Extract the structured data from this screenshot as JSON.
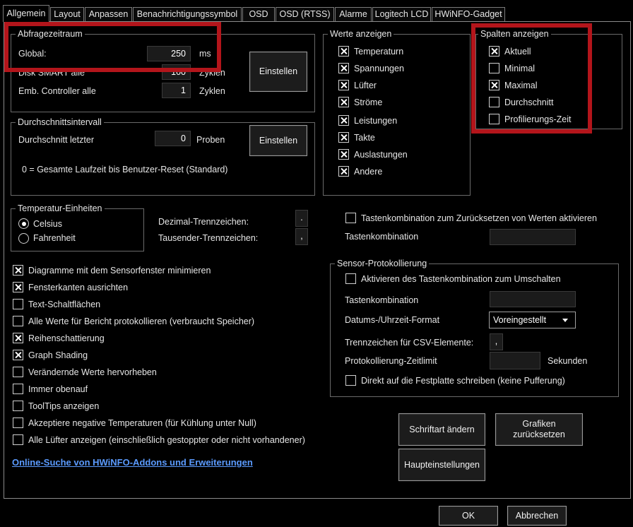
{
  "tabs": [
    "Allgemein",
    "Layout",
    "Anpassen",
    "Benachrichtigungssymbol",
    "OSD",
    "OSD (RTSS)",
    "Alarme",
    "Logitech LCD",
    "HWiNFO-Gadget"
  ],
  "poll": {
    "legend": "Abfragezeitraum",
    "global_label": "Global:",
    "global_value": "250",
    "global_unit": "ms",
    "smart_label": "Disk SMART alle",
    "smart_value": "100",
    "smart_unit": "Zyklen",
    "emb_label": "Emb. Controller alle",
    "emb_value": "1",
    "emb_unit": "Zyklen",
    "button": "Einstellen"
  },
  "avg": {
    "legend": "Durchschnittsintervall",
    "label": "Durchschnitt letzter",
    "value": "0",
    "unit": "Proben",
    "button": "Einstellen",
    "note": "0 = Gesamte Laufzeit bis Benutzer-Reset (Standard)"
  },
  "values": {
    "legend": "Werte anzeigen",
    "items": [
      {
        "label": "Temperaturn",
        "checked": true
      },
      {
        "label": "Spannungen",
        "checked": true
      },
      {
        "label": "Lüfter",
        "checked": true
      },
      {
        "label": "Ströme",
        "checked": true
      },
      {
        "label": "Leistungen",
        "checked": true
      },
      {
        "label": "Takte",
        "checked": true
      },
      {
        "label": "Auslastungen",
        "checked": true
      },
      {
        "label": "Andere",
        "checked": true
      }
    ]
  },
  "columns": {
    "legend": "Spalten anzeigen",
    "items": [
      {
        "label": "Aktuell",
        "checked": true
      },
      {
        "label": "Minimal",
        "checked": false
      },
      {
        "label": "Maximal",
        "checked": true
      },
      {
        "label": "Durchschnitt",
        "checked": false
      },
      {
        "label": "Profilierungs-Zeit",
        "checked": false
      }
    ]
  },
  "temp_units": {
    "legend": "Temperatur-Einheiten",
    "celsius": "Celsius",
    "fahrenheit": "Fahrenheit",
    "selected": "Celsius"
  },
  "separators": {
    "decimal_label": "Dezimal-Trennzeichen:",
    "decimal_value": ".",
    "thousand_label": "Tausender-Trennzeichen:",
    "thousand_value": ","
  },
  "options": [
    {
      "label": "Diagramme mit dem Sensorfenster minimieren",
      "checked": true
    },
    {
      "label": "Fensterkanten ausrichten",
      "checked": true
    },
    {
      "label": "Text-Schaltflächen",
      "checked": false
    },
    {
      "label": "Alle Werte für Bericht protokollieren (verbraucht Speicher)",
      "checked": false
    },
    {
      "label": "Reihenschattierung",
      "checked": true
    },
    {
      "label": "Graph Shading",
      "checked": true
    },
    {
      "label": "Verändernde Werte hervorheben",
      "checked": false
    },
    {
      "label": "Immer obenauf",
      "checked": false
    },
    {
      "label": "ToolTips anzeigen",
      "checked": false
    },
    {
      "label": "Akzeptiere negative Temperaturen (für Kühlung unter Null)",
      "checked": false
    },
    {
      "label": "Alle Lüfter anzeigen (einschließlich gestoppter oder nicht vorhandener)",
      "checked": false
    }
  ],
  "reset_hotkey": {
    "checkbox_label": "Tastenkombination zum Zurücksetzen von Werten aktivieren",
    "checked": false,
    "hotkey_label": "Tastenkombination",
    "hotkey_value": ""
  },
  "logging": {
    "legend": "Sensor-Protokollierung",
    "toggle_label": "Aktivieren des Tastenkombination zum Umschalten",
    "toggle_checked": false,
    "hotkey_label": "Tastenkombination",
    "hotkey_value": "",
    "datetime_label": "Datums-/Uhrzeit-Format",
    "datetime_value": "Voreingestellt",
    "csv_label": "Trennzeichen für CSV-Elemente:",
    "csv_value": ",",
    "timelimit_label": "Protokollierung-Zeitlimit",
    "timelimit_value": "",
    "timelimit_unit": "Sekunden",
    "direct_label": "Direkt auf die Festplatte schreiben (keine Pufferung)",
    "direct_checked": false
  },
  "link": "Online-Suche von HWiNFO-Addons und Erweiterungen",
  "buttons": {
    "font": "Schriftart ändern",
    "reset_graphs": "Grafiken zurücksetzen",
    "main_settings": "Haupteinstellungen",
    "ok": "OK",
    "cancel": "Abbrechen"
  },
  "colors": {
    "highlight": "#b3151b",
    "link": "#5b9bff",
    "background": "#000000"
  }
}
